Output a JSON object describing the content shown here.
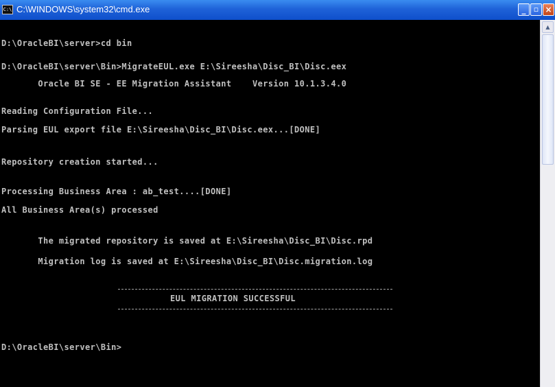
{
  "window": {
    "title": "C:\\WINDOWS\\system32\\cmd.exe",
    "icon_text": "C:\\",
    "buttons": {
      "minimize": "_",
      "maximize": "▫",
      "close": "×"
    }
  },
  "console": {
    "lines": [
      "D:\\OracleBI\\server>cd bin",
      "D:\\OracleBI\\server\\Bin>MigrateEUL.exe E:\\Sireesha\\Disc_BI\\Disc.eex",
      "       Oracle BI SE - EE Migration Assistant    Version 10.1.3.4.0",
      "Reading Configuration File...",
      "Parsing EUL export file E:\\Sireesha\\Disc_BI\\Disc.eex...[DONE]",
      "Repository creation started...",
      "Processing Business Area : ab_test....[DONE]",
      "All Business Area(s) processed",
      "       The migrated repository is saved at E:\\Sireesha\\Disc_BI\\Disc.rpd",
      "       Migration log is saved at E:\\Sireesha\\Disc_BI\\Disc.migration.log",
      "EUL MIGRATION SUCCESSFUL",
      "D:\\OracleBI\\server\\Bin>"
    ]
  },
  "colors": {
    "console_bg": "#000000",
    "console_text": "#c0c0c0",
    "titlebar": "#1f62d8",
    "close_button": "#c24418"
  },
  "scrollbar": {
    "up_arrow": "▲"
  }
}
